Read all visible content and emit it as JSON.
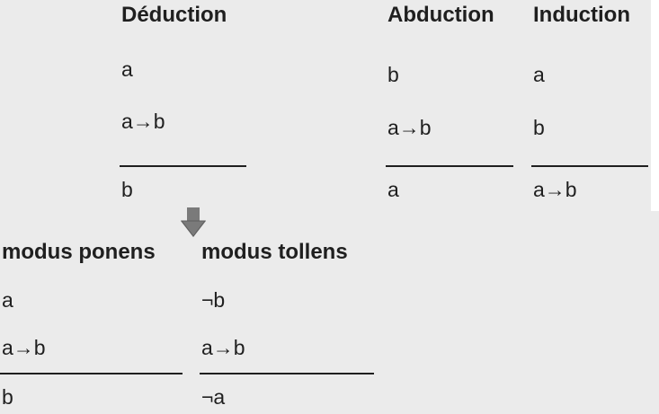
{
  "deduction": {
    "title": "Déduction",
    "premise1": "a",
    "premise2": "a→b",
    "conclusion": "b"
  },
  "abduction": {
    "title": "Abduction",
    "premise1": "b",
    "premise2": "a→b",
    "conclusion": "a"
  },
  "induction": {
    "title": "Induction",
    "premise1": "a",
    "premise2": "b",
    "conclusion": "a→b"
  },
  "modus_ponens": {
    "title": "modus ponens",
    "premise1": "a",
    "premise2": "a→b",
    "conclusion": "b"
  },
  "modus_tollens": {
    "title": "modus tollens",
    "premise1": "¬b",
    "premise2": "a→b",
    "conclusion": "¬a"
  },
  "colors": {
    "background": "#ebebeb",
    "text": "#1f1f1f",
    "arrow": "#7a7a7a"
  },
  "icons": {
    "arrow": "down-arrow-icon"
  }
}
